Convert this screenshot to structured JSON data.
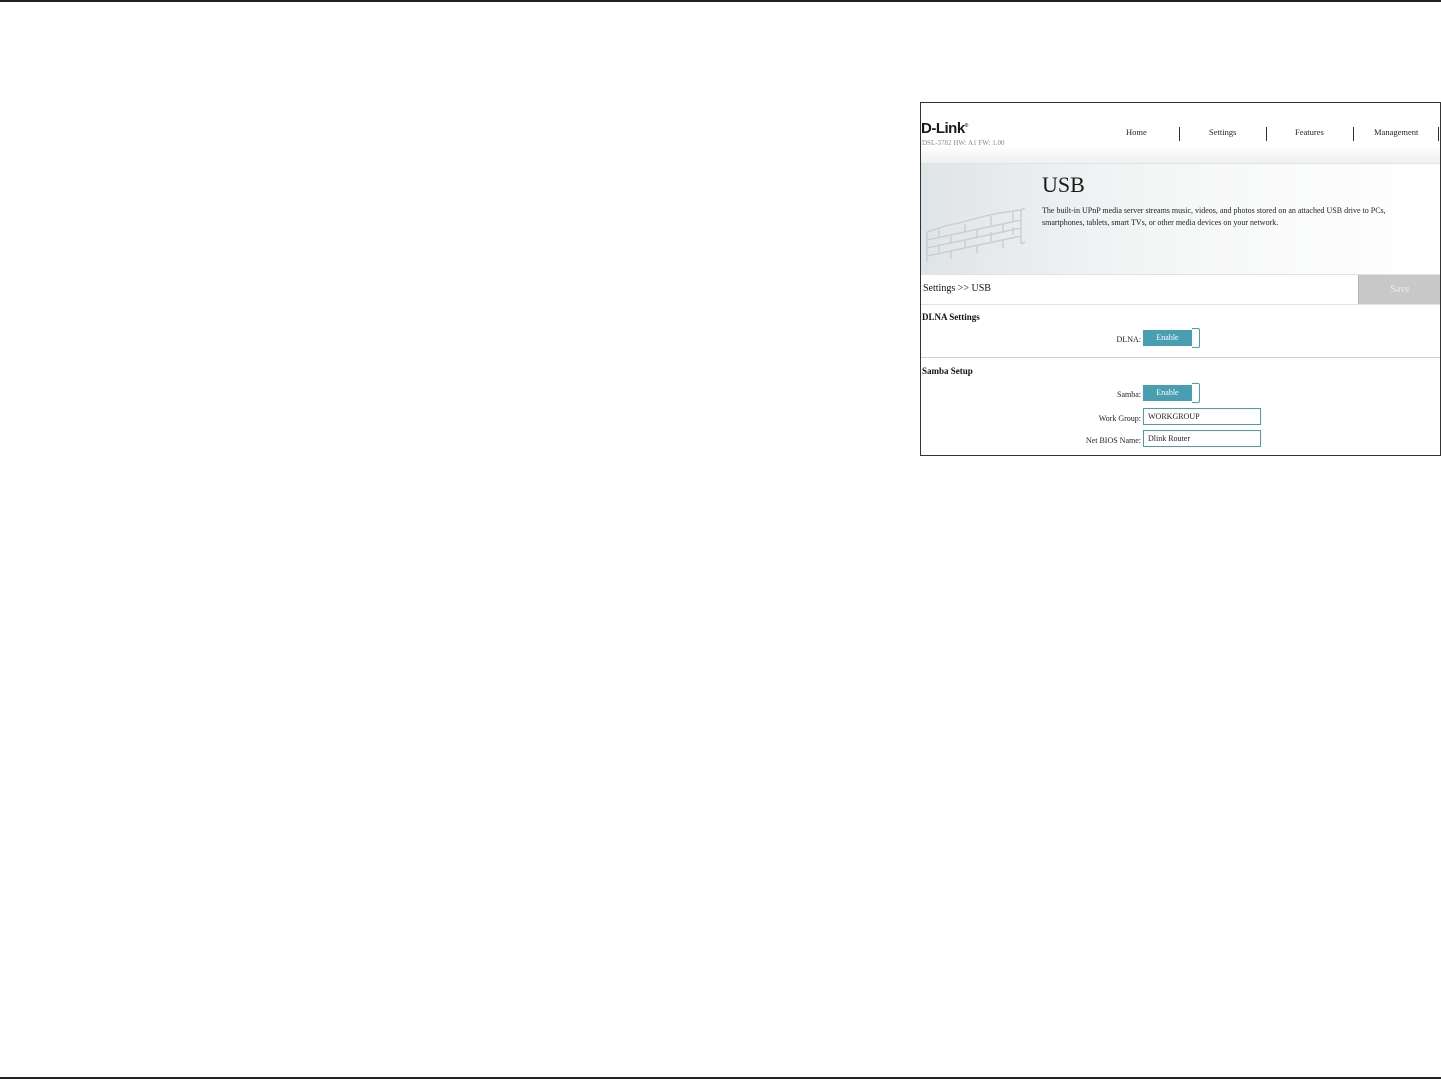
{
  "header": {
    "brand": "D-Link",
    "model_info": "DSL-3782  HW: A1  FW: 1.00",
    "nav": [
      "Home",
      "Settings",
      "Features",
      "Management"
    ]
  },
  "banner": {
    "title": "USB",
    "description": "The built-in UPnP media server streams music, videos, and photos stored on an attached USB drive to PCs, smartphones, tablets, smart TVs, or other media devices on your network."
  },
  "breadcrumb": "Settings >> USB",
  "save_label": "Save",
  "dlna": {
    "section_title": "DLNA Settings",
    "label": "DLNA:",
    "toggle_label": "Enable"
  },
  "samba": {
    "section_title": "Samba Setup",
    "label": "Samba:",
    "toggle_label": "Enable",
    "workgroup_label": "Work Group:",
    "workgroup_value": "WORKGROUP",
    "netbios_label": "Net BIOS Name:",
    "netbios_value": "Dlink Router"
  },
  "colors": {
    "accent": "#4a9eb2",
    "save_disabled": "#c8c8c8"
  }
}
